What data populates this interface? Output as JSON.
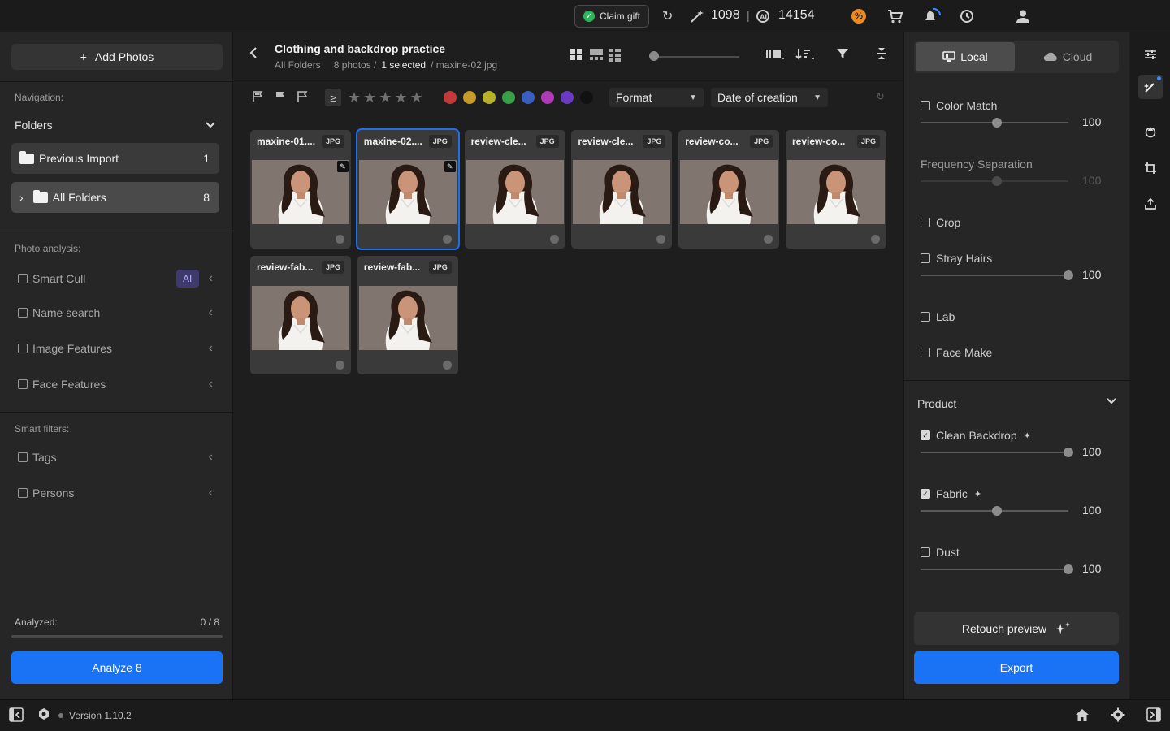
{
  "topbar": {
    "claim_label": "Claim gift",
    "credits_magic": "1098",
    "separator": "|",
    "credits_ai": "14154",
    "promo_badge": "%"
  },
  "sidebar": {
    "add_photos": "Add Photos",
    "navigation_label": "Navigation:",
    "folders_label": "Folders",
    "folders": [
      {
        "label": "Previous Import",
        "count": "1"
      },
      {
        "label": "All Folders",
        "count": "8"
      }
    ],
    "photo_analysis_label": "Photo analysis:",
    "analysis": [
      {
        "label": "Smart Cull",
        "badge": "AI"
      },
      {
        "label": "Name search"
      },
      {
        "label": "Image Features"
      },
      {
        "label": "Face Features"
      }
    ],
    "smart_filters_label": "Smart filters:",
    "smart_filters": [
      {
        "label": "Tags"
      },
      {
        "label": "Persons"
      }
    ],
    "analyzed_label": "Analyzed:",
    "analyzed_value": "0 / 8",
    "analyzed_fraction": 0,
    "analyze_button": "Analyze 8"
  },
  "center": {
    "title": "Clothing and backdrop practice",
    "breadcrumb_root": "All Folders",
    "photo_count": "8 photos /",
    "selected": "1 selected",
    "selected_file": "/ maxine-02.jpg",
    "zoom_level": 0,
    "format_dropdown": "Format",
    "sort_dropdown": "Date of creation",
    "rating_filter_symbol": "≥",
    "color_labels": [
      "#c23a3a",
      "#c89a2a",
      "#b8b22a",
      "#3aa04a",
      "#3a5fc0",
      "#b03ab8",
      "#6a3ac0",
      "#111111"
    ],
    "photos": [
      {
        "name": "maxine-01....",
        "format": "JPG",
        "edited": true,
        "selected": false
      },
      {
        "name": "maxine-02....",
        "format": "JPG",
        "edited": true,
        "selected": true
      },
      {
        "name": "review-cle...",
        "format": "JPG",
        "edited": false,
        "selected": false
      },
      {
        "name": "review-cle...",
        "format": "JPG",
        "edited": false,
        "selected": false
      },
      {
        "name": "review-co...",
        "format": "JPG",
        "edited": false,
        "selected": false
      },
      {
        "name": "review-co...",
        "format": "JPG",
        "edited": false,
        "selected": false
      },
      {
        "name": "review-fab...",
        "format": "JPG",
        "edited": false,
        "selected": false
      },
      {
        "name": "review-fab...",
        "format": "JPG",
        "edited": false,
        "selected": false
      }
    ]
  },
  "right_panel": {
    "tab_local": "Local",
    "tab_cloud": "Cloud",
    "active_tab": "local",
    "options": [
      {
        "label": "Color Match",
        "checked": false,
        "value": "100",
        "level": 0.5,
        "has_slider": true
      },
      {
        "label": "Frequency Separation",
        "plain": true,
        "value": "100",
        "level": 0.5,
        "has_slider": true,
        "disabled": true
      },
      {
        "label": "Crop",
        "checked": false,
        "has_slider": false
      },
      {
        "label": "Stray Hairs",
        "checked": false,
        "value": "100",
        "level": 1.0,
        "has_slider": true
      },
      {
        "label": "Lab",
        "checked": false,
        "has_slider": false
      },
      {
        "label": "Face Make",
        "checked": false,
        "has_slider": false
      }
    ],
    "product_label": "Product",
    "product_options": [
      {
        "label": "Clean Backdrop",
        "checked": true,
        "value": "100",
        "level": 1.0,
        "ai": true
      },
      {
        "label": "Fabric",
        "checked": true,
        "value": "100",
        "level": 0.5,
        "ai": true
      },
      {
        "label": "Dust",
        "checked": false,
        "value": "100",
        "level": 1.0,
        "ai": false
      }
    ],
    "retouch_preview": "Retouch preview",
    "export": "Export"
  },
  "bottom": {
    "version": "Version 1.10.2"
  }
}
